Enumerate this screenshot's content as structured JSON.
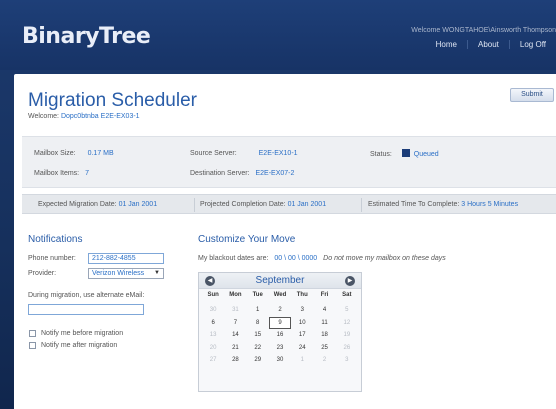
{
  "header": {
    "logo": "BinaryTree",
    "welcome": "Welcome WONGTAHOE\\Ainsworth Thompson",
    "nav": [
      "Home",
      "About",
      "Log Off"
    ]
  },
  "page": {
    "title": "Migration Scheduler",
    "welcome_label": "Welcome:",
    "welcome_user": "Dopc0btnba E2E-EX03-1",
    "submit_label": "Submit"
  },
  "info": {
    "mailbox_size_label": "Mailbox Size:",
    "mailbox_size": "0.17 MB",
    "mailbox_items_label": "Mailbox Items:",
    "mailbox_items": "7",
    "source_server_label": "Source Server:",
    "source_server": "E2E-EX10-1",
    "dest_server_label": "Destination Server:",
    "dest_server": "E2E-EX07-2",
    "status_label": "Status:",
    "status": "Queued",
    "status_color": "#1b3c78"
  },
  "dates": {
    "expected_label": "Expected Migration Date:",
    "expected": "01 Jan 2001",
    "projected_label": "Projected Completion Date:",
    "projected": "01 Jan 2001",
    "estimated_label": "Estimated Time To Complete:",
    "estimated": "3 Hours 5 Minutes"
  },
  "notifications": {
    "heading": "Notifications",
    "phone_label": "Phone number:",
    "phone": "212-882-4855",
    "provider_label": "Provider:",
    "provider": "Verizon Wireless",
    "alt_email_label": "During migration, use alternate eMail:",
    "alt_email": "",
    "notify_before": "Notify me before migration",
    "notify_after": "Notify me after migration"
  },
  "customize": {
    "heading": "Customize Your Move",
    "blackout_label": "My blackout dates are:",
    "blackout_value": "00 \\ 00 \\ 0000",
    "blackout_note": "Do not move my mailbox on these days"
  },
  "calendar": {
    "month": "September",
    "prev_icon": "◀",
    "next_icon": "▶",
    "days_of_week": [
      "Sun",
      "Mon",
      "Tue",
      "Wed",
      "Thu",
      "Fri",
      "Sat"
    ],
    "weeks": [
      [
        {
          "d": "30",
          "dim": true
        },
        {
          "d": "31",
          "dim": true
        },
        {
          "d": "1"
        },
        {
          "d": "2"
        },
        {
          "d": "3"
        },
        {
          "d": "4"
        },
        {
          "d": "5",
          "dim": true
        }
      ],
      [
        {
          "d": "6"
        },
        {
          "d": "7"
        },
        {
          "d": "8"
        },
        {
          "d": "9",
          "sel": true
        },
        {
          "d": "10"
        },
        {
          "d": "11"
        },
        {
          "d": "12",
          "dim": true
        }
      ],
      [
        {
          "d": "13",
          "dim": true
        },
        {
          "d": "14"
        },
        {
          "d": "15"
        },
        {
          "d": "16"
        },
        {
          "d": "17"
        },
        {
          "d": "18"
        },
        {
          "d": "19",
          "dim": true
        }
      ],
      [
        {
          "d": "20",
          "dim": true
        },
        {
          "d": "21"
        },
        {
          "d": "22"
        },
        {
          "d": "23"
        },
        {
          "d": "24"
        },
        {
          "d": "25"
        },
        {
          "d": "26",
          "dim": true
        }
      ],
      [
        {
          "d": "27",
          "dim": true
        },
        {
          "d": "28"
        },
        {
          "d": "29"
        },
        {
          "d": "30"
        },
        {
          "d": "1",
          "dim": true
        },
        {
          "d": "2",
          "dim": true
        },
        {
          "d": "3",
          "dim": true
        }
      ]
    ]
  }
}
